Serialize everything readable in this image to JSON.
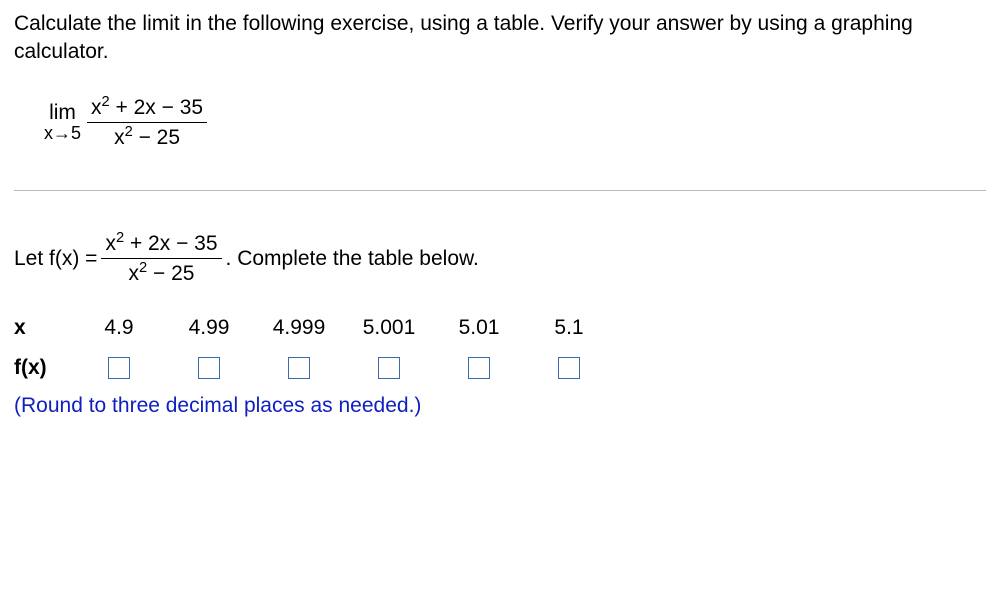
{
  "instruction": "Calculate the limit in the following exercise, using a table. Verify your answer by using a graphing calculator.",
  "limit": {
    "lim_text": "lim",
    "approach": "x→5",
    "numerator_html": "x² + 2x − 35",
    "denominator_html": "x² − 25"
  },
  "let_prefix": "Let f(x) =",
  "let_suffix": ". Complete the table below.",
  "fx_numerator": "x² + 2x − 35",
  "fx_denominator": "x² − 25",
  "table": {
    "row1_label": "x",
    "row2_label": "f(x)",
    "x_values": [
      "4.9",
      "4.99",
      "4.999",
      "5.001",
      "5.01",
      "5.1"
    ]
  },
  "note": "(Round to three decimal places as needed.)",
  "chart_data": {
    "type": "table",
    "columns": [
      "x",
      "f(x)"
    ],
    "rows": [
      {
        "x": 4.9,
        "f(x)": null
      },
      {
        "x": 4.99,
        "f(x)": null
      },
      {
        "x": 4.999,
        "f(x)": null
      },
      {
        "x": 5.001,
        "f(x)": null
      },
      {
        "x": 5.01,
        "f(x)": null
      },
      {
        "x": 5.1,
        "f(x)": null
      }
    ],
    "title": "Limit table for f(x) = (x² + 2x − 35)/(x² − 25) as x → 5"
  }
}
